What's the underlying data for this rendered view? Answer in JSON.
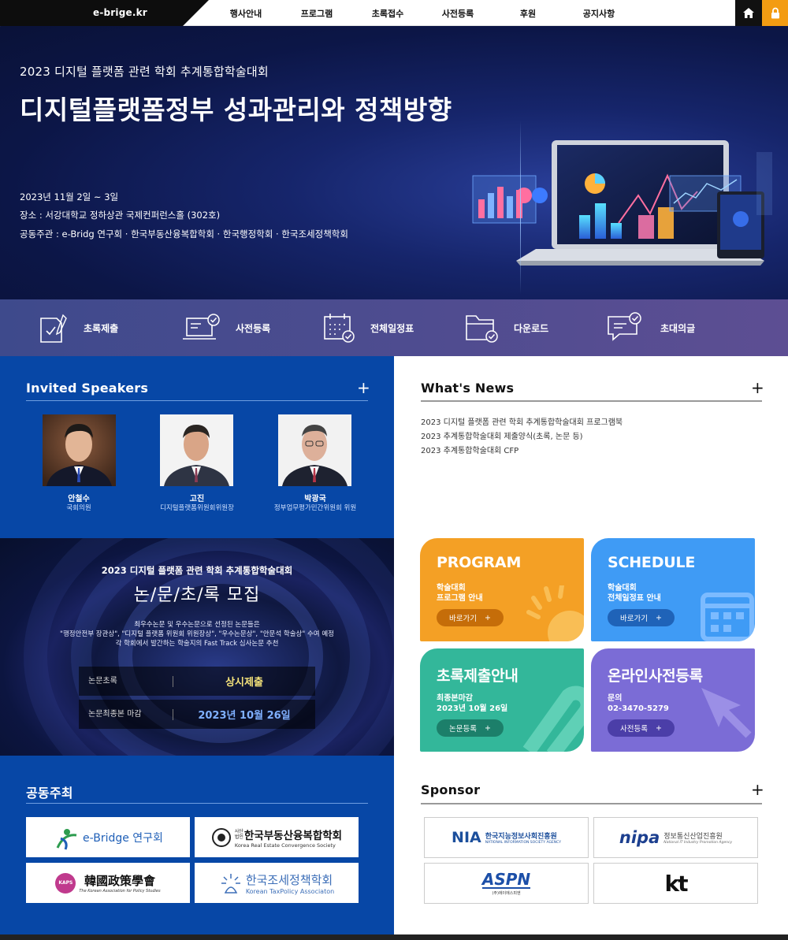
{
  "header": {
    "logo": "e-brige.kr",
    "nav": [
      "행사안내",
      "프로그램",
      "초록접수",
      "사전등록",
      "후원",
      "공지사항"
    ],
    "home_icon": "home-icon",
    "lock_icon": "lock-icon",
    "accent": "#f39c12"
  },
  "hero": {
    "subtitle": "2023 디지털 플랫폼 관련 학회 추계통합학술대회",
    "title": "디지털플랫폼정부 성과관리와 정책방향",
    "date": "2023년 11월 2일 ~ 3일",
    "venue": "장소 : 서강대학교 정하상관 국제컨퍼런스홀 (302호)",
    "hosts": "공동주관 :  e-Bridg 연구회 · 한국부동산융복합학회 · 한국행정학회 · 한국조세정책학회"
  },
  "quick": [
    {
      "label": "초록제출",
      "icon": "document-sign-icon"
    },
    {
      "label": "사전등록",
      "icon": "laptop-check-icon"
    },
    {
      "label": "전체일정표",
      "icon": "calendar-check-icon"
    },
    {
      "label": "다운로드",
      "icon": "folder-check-icon"
    },
    {
      "label": "초대의글",
      "icon": "chat-check-icon"
    }
  ],
  "speakers": {
    "title": "Invited Speakers",
    "plus": "+",
    "items": [
      {
        "name": "안철수",
        "role": "국회의원"
      },
      {
        "name": "고진",
        "role": "디지털플랫폼위원회위원장"
      },
      {
        "name": "박광국",
        "role": "정부업무평가민간위원회 위원"
      }
    ]
  },
  "news": {
    "title": "What's News",
    "plus": "+",
    "items": [
      "2023 디지털 플랫폼 관련 학회 추계통합학술대회 프로그램북",
      "2023 추계통합학술대회 제출양식(초록, 논문 등)",
      "2023 추계통합학술대회 CFP"
    ]
  },
  "cfp": {
    "top": "2023 디지털 플랫폼 관련 학회 추계통합학술대회",
    "title": "논/문/초/록 모집",
    "desc": [
      "최우수논문 및 우수논문으로 선정된 논문들은",
      "\"행정안전부 장관상\", \"디지털 플랫폼 위원회 위원장상\", \"우수논문상\", \"안문석 학술상\" 수여 예정",
      "각 학회에서 발간하는 학술지의 Fast Track 심사논문 추천"
    ],
    "rows": [
      {
        "key": "논문초록",
        "value": "상시제출",
        "color": "#f5e37a"
      },
      {
        "key": "논문최종본 마감",
        "value": "2023년 10월 26일",
        "color": "#7fb0ff"
      }
    ]
  },
  "tiles": [
    {
      "title": "PROGRAM",
      "desc": [
        "학술대회",
        "프로그램 안내"
      ],
      "btn": "바로가기",
      "bg": "#f4a025",
      "btnbg": "#c56d09"
    },
    {
      "title": "SCHEDULE",
      "desc": [
        "학술대회",
        "전체일정표 안내"
      ],
      "btn": "바로가기",
      "bg": "#3f9bf5",
      "btnbg": "#1f63b8"
    },
    {
      "title": "초록제출안내",
      "desc": [
        "최종본마감",
        "2023년 10월 26일"
      ],
      "btn": "논문등록",
      "bg": "#33b79a",
      "btnbg": "#1c7f6a"
    },
    {
      "title": "온라인사전등록",
      "desc": [
        "문의",
        "02-3470-5279"
      ],
      "btn": "사전등록",
      "bg": "#7b6cd6",
      "btnbg": "#4b3ea8"
    }
  ],
  "cohost": {
    "title": "공동주최",
    "logos": [
      {
        "name": "e-Bridge 연구회"
      },
      {
        "name": "한국부동산융복합학회",
        "sub": "Korea Real Estate Convergence Society",
        "badge": "사단법인"
      },
      {
        "name": "韓國政策學會",
        "sub": "The Korean Association for Policy Studies",
        "badge": "KAPS"
      },
      {
        "name": "한국조세정책학회",
        "sub": "Korean TaxPolicy Associaton"
      }
    ]
  },
  "sponsor": {
    "title": "Sponsor",
    "plus": "+",
    "logos": [
      {
        "mark": "NIA",
        "name": "한국지능정보사회진흥원",
        "sub": "NATIONAL INFORMATION SOCIETY AGENCY"
      },
      {
        "mark": "nipa",
        "name": "정보통신산업진흥원",
        "sub": "National IT Industry Promotion Agency"
      },
      {
        "mark": "ASPN",
        "sub": "(주)에이에스피엔"
      },
      {
        "mark": "kt"
      }
    ]
  }
}
